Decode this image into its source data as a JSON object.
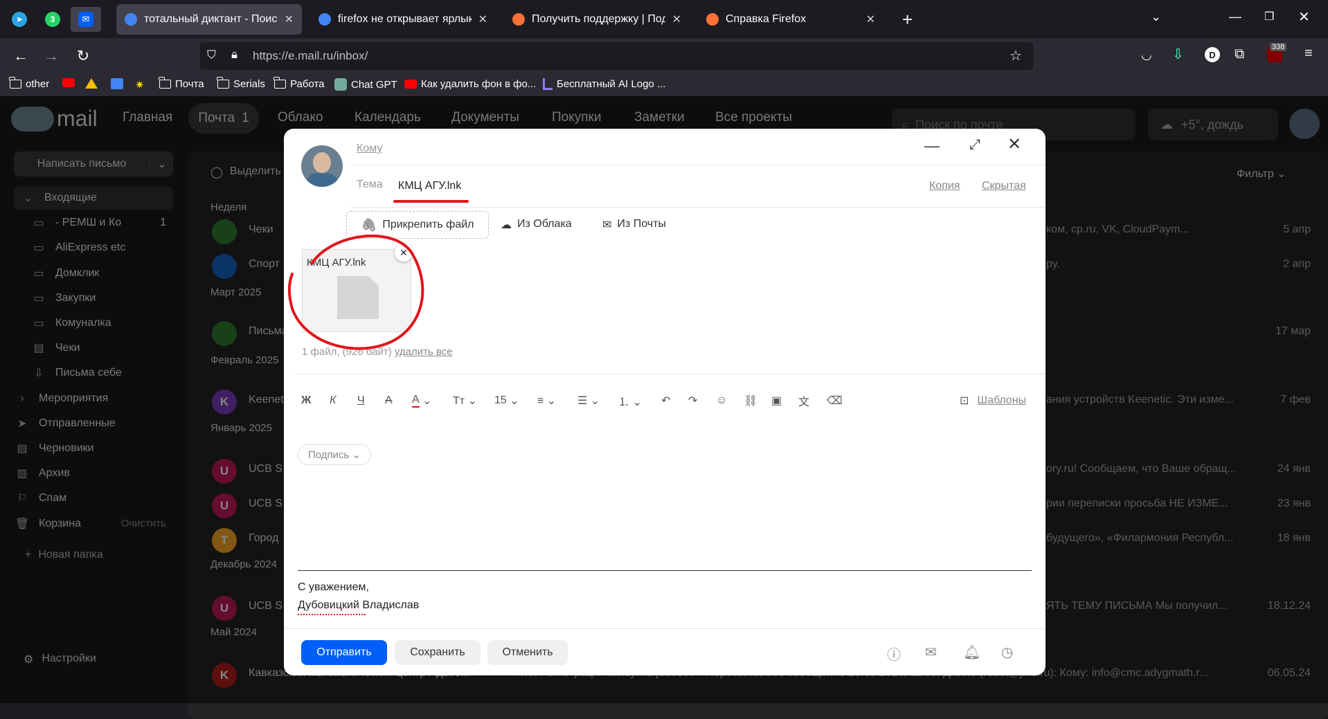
{
  "browser": {
    "tabs": [
      {
        "title": "тотальный диктант - Поиск в Google",
        "active": true,
        "color": "#4285f4"
      },
      {
        "title": "firefox не открывает ярлык папки",
        "active": false,
        "color": "#4285f4"
      },
      {
        "title": "Получить поддержку | Поддержка",
        "active": false,
        "color": "#ff7139"
      },
      {
        "title": "Справка Firefox",
        "active": false,
        "color": "#ff7139"
      }
    ],
    "pinned_badge": "3",
    "url": "https://e.mail.ru/inbox/",
    "url_domain": "mail.ru",
    "ext_badge": "338",
    "profile_letter": "D",
    "bookmarks": [
      "other",
      "Почта",
      "Serials",
      "Работа",
      "Chat GPT",
      "Как удалить фон в фо...",
      "Бесплатный AI Logo ..."
    ]
  },
  "mail": {
    "logo": "mail",
    "nav": [
      "Главная",
      "Почта",
      "Облако",
      "Календарь",
      "Документы",
      "Покупки",
      "Заметки",
      "Все проекты"
    ],
    "mail_badge": "1",
    "search_placeholder": "Поиск по почте",
    "weather": "+5°, дождь",
    "compose_button": "Написать письмо",
    "sidebar": [
      {
        "label": "Входящие",
        "icon": "chevron-down-icon"
      },
      {
        "label": "- РЕМШ и Ко",
        "icon": "folder-icon",
        "count": "1"
      },
      {
        "label": "AliExpress etc",
        "icon": "folder-icon"
      },
      {
        "label": "Домклик",
        "icon": "folder-icon"
      },
      {
        "label": "Закупки",
        "icon": "folder-icon"
      },
      {
        "label": "Комуналка",
        "icon": "folder-icon"
      },
      {
        "label": "Чеки",
        "icon": "receipt-icon"
      },
      {
        "label": "Письма себе",
        "icon": "download-icon"
      },
      {
        "label": "Мероприятия",
        "icon": "chevron-right-icon"
      },
      {
        "label": "Отправленные",
        "icon": "send-icon"
      },
      {
        "label": "Черновики",
        "icon": "draft-icon"
      },
      {
        "label": "Архив",
        "icon": "archive-icon"
      },
      {
        "label": "Спам",
        "icon": "spam-icon"
      },
      {
        "label": "Корзина",
        "icon": "trash-icon",
        "action": "Очистить"
      }
    ],
    "new_folder": "Новая папка",
    "settings": "Настройки",
    "select_all": "Выделить",
    "filter": "Фильтр",
    "groups": [
      "Неделя",
      "Март 2025",
      "Февраль 2025",
      "Январь 2025",
      "Декабрь 2024",
      "Май 2024"
    ],
    "rows": [
      {
        "sender": "Чеки",
        "snippet": "ком, cp.ru, VK, CloudPaym...",
        "date": "5 апр",
        "avatar": "",
        "color": "#2e7d32"
      },
      {
        "sender": "Спорт",
        "snippet": "ру.",
        "date": "2 апр",
        "avatar": "",
        "color": "#1565c0"
      },
      {
        "sender": "Письма",
        "snippet": "",
        "date": "17 мар",
        "avatar": "",
        "color": "#2e7d32"
      },
      {
        "sender": "Keenetic",
        "snippet": "ания устройств Keenetic. Эти изме...",
        "date": "7 фев",
        "avatar": "K",
        "color": "#7b3fbf"
      },
      {
        "sender": "UCB S",
        "snippet": "ory.ru! Сообщаем, что Ваше обращ...",
        "date": "24 янв",
        "avatar": "U",
        "color": "#c2185b"
      },
      {
        "sender": "UCB S",
        "snippet": "рии переписки просьба НЕ ИЗМЕ...",
        "date": "23 янв",
        "avatar": "U",
        "color": "#c2185b"
      },
      {
        "sender": "Город",
        "snippet": "будущего», «Филармония Республ...",
        "date": "18 янв",
        "avatar": "T",
        "color": "#f9a825"
      },
      {
        "sender": "UCB S",
        "snippet": "ЯТЬ ТЕМУ ПИСЬМА Мы получил...",
        "date": "18.12.24",
        "avatar": "U",
        "color": "#c2185b"
      },
      {
        "sender": "Кавказский математический центр Адыге...",
        "snippet": "Fwd: Регистрация аккаунта j00556T · Пересылаемое сообщение 20.05.2016, 11:05, Джино (robot@jino.ru): Кому: info@cmc.adygmath.r...",
        "date": "06.05.24",
        "avatar": "K",
        "color": "#b71c1c"
      }
    ]
  },
  "compose": {
    "to_label": "Кому",
    "subject_label": "Тема",
    "subject_value": "КМЦ АГУ.lnk",
    "cc": "Копия",
    "bcc": "Скрытая",
    "attach_file": "Прикрепить файл",
    "from_cloud": "Из Облака",
    "from_mail": "Из Почты",
    "attachment_name": "КМЦ АГУ.lnk",
    "attachment_summary": "1 файл, (926 байт)",
    "delete_all": "удалить все",
    "font_size": "15",
    "templates": "Шаблоны",
    "signature_btn": "Подпись",
    "signature_line1": "С уважением,",
    "signature_line2": "Дубовицкий Владислав",
    "send": "Отправить",
    "save": "Сохранить",
    "cancel": "Отменить",
    "accent": "#005ff9",
    "annotation_color": "#e0161c"
  }
}
